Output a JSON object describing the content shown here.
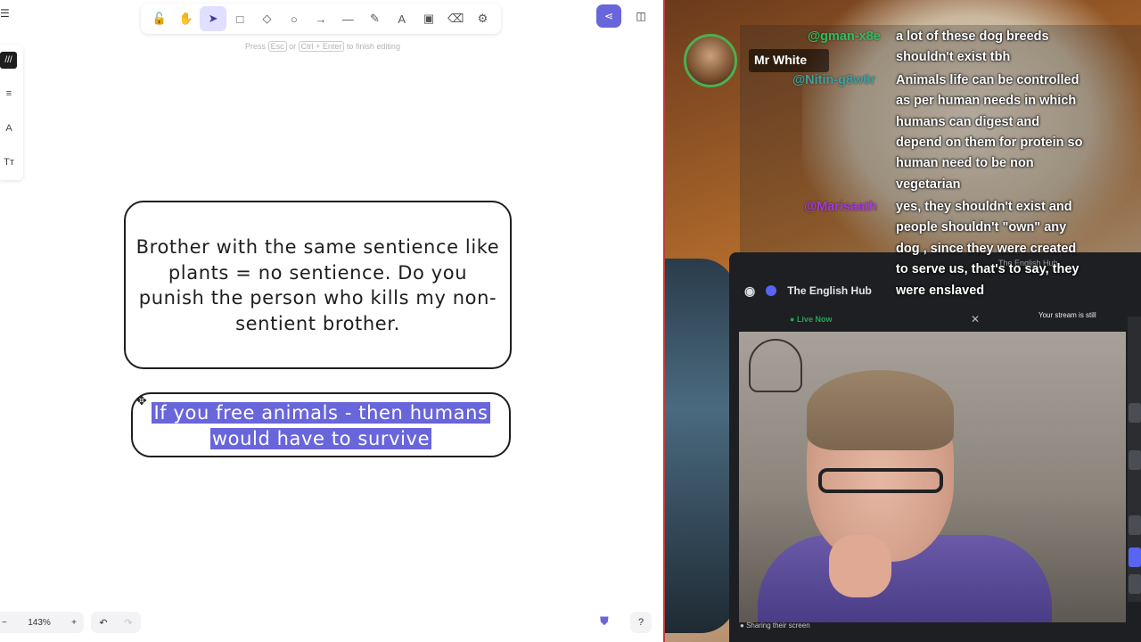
{
  "toolbar": {
    "tools": [
      "lock-icon",
      "hand-icon",
      "select-icon",
      "rectangle-icon",
      "diamond-icon",
      "ellipse-icon",
      "arrow-icon",
      "line-icon",
      "pencil-icon",
      "text-icon",
      "image-icon",
      "eraser-icon",
      "extra-tools-icon"
    ],
    "active_tool": "select-icon",
    "hint_prefix": "Press",
    "hint_key1": "Esc",
    "hint_or": "or",
    "hint_key2": "Ctrl + Enter",
    "hint_suffix": "to finish editing"
  },
  "side_panel": {
    "items": [
      "stroke-icon",
      "sliders-icon",
      "font-icon",
      "font-size-icon"
    ]
  },
  "canvas": {
    "card1_text": "Brother with the same sentience like plants = no sentience. Do you punish the person who kills my non-sentient brother.",
    "card2_line1": "If you free animals - then humans",
    "card2_line2": "would have to survive"
  },
  "footer": {
    "zoom_minus": "−",
    "zoom_level": "143%",
    "zoom_plus": "+",
    "undo": "↶",
    "redo": "↷",
    "help": "?"
  },
  "colors": {
    "accent": "#6965db",
    "selection": "#6965db",
    "discord_bg": "#1e1f22",
    "live": "#23a55a"
  },
  "stream": {
    "streamer_name": "Mr White",
    "chat": [
      {
        "user": "@gman-x8e",
        "user_color": "#2ebd5f",
        "lines": [
          "a lot of these dog breeds",
          "shouldn't exist tbh"
        ]
      },
      {
        "user": "@Nitin-g8w0r",
        "user_color": "#3aa0a0",
        "lines": [
          "Animals life can be controlled",
          "as per human needs in which",
          "humans can digest and",
          "depend on them for protein so",
          "human need to be non",
          "vegetarian"
        ]
      },
      {
        "user": "@Marisaath",
        "user_color": "#a43ad8",
        "lines": [
          "yes, they shouldn't exist and",
          "people shouldn't \"own\" any",
          "dog , since they were created",
          "to serve us, that's to say, they",
          "were enslaved"
        ]
      }
    ],
    "watermark": "The English Hub",
    "stream_note": "Your stream is still"
  },
  "discord": {
    "server_name": "The English Hub",
    "live_label": "Live Now",
    "footer_text": "Sharing their screen",
    "close": "✕"
  }
}
